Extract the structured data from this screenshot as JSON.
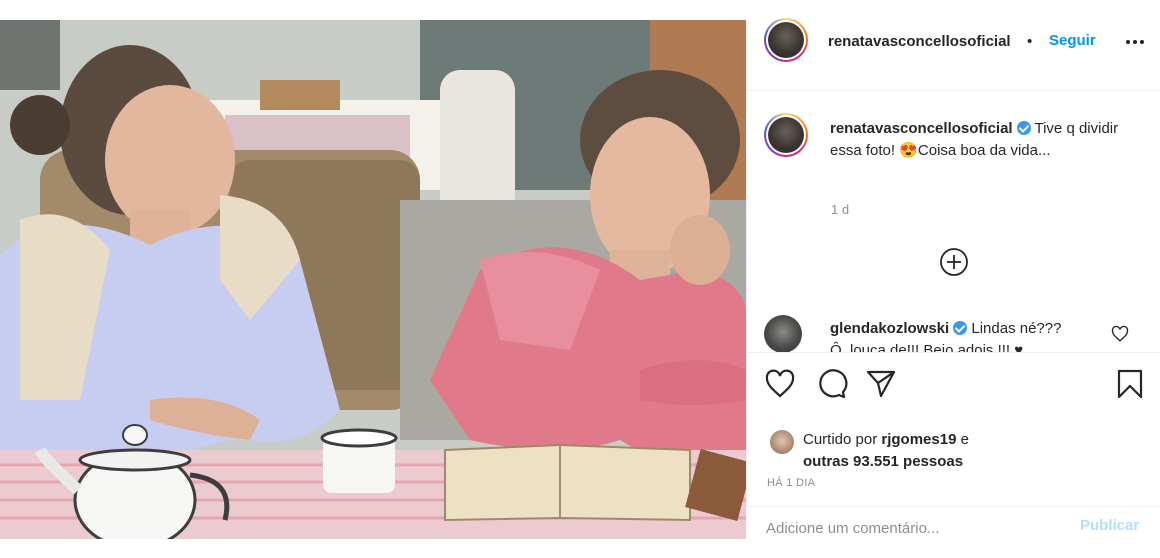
{
  "post": {
    "image_alt": "Two women sitting at a table reading a book"
  },
  "header": {
    "username": "renatavasconcellosoficial",
    "dot": "•",
    "follow_label": "Seguir"
  },
  "caption": {
    "username": "renatavasconcellosoficial",
    "text_part1": " Tive q dividir essa foto! ",
    "emoji": "😍",
    "text_part2": "Coisa boa da vida...",
    "time": "1 d"
  },
  "comment": {
    "username": "glendakozlowski",
    "text": " Lindas né???",
    "text_line2": "Ô, louca de!!! Bejo.adois.!!! ♥"
  },
  "likes": {
    "prefix": "Curtido por ",
    "user": "rjgomes19",
    "middle": " e",
    "others": "outras 93.551 pessoas"
  },
  "post_age": "HÁ 1 DIA",
  "comment_box": {
    "placeholder": "Adicione um comentário...",
    "publish_label": "Publicar"
  },
  "colors": {
    "accent": "#0095f6",
    "publish_disabled": "#b2dffc",
    "verified": "#3897f0"
  }
}
